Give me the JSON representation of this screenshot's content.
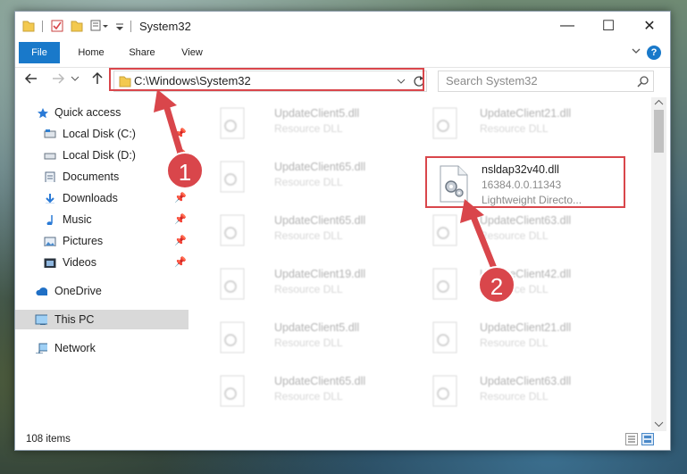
{
  "window": {
    "title": "System32",
    "controls": {
      "minimize": "—",
      "maximize": "☐",
      "close": "✕"
    }
  },
  "ribbon": {
    "tabs": [
      {
        "label": "File"
      },
      {
        "label": "Home"
      },
      {
        "label": "Share"
      },
      {
        "label": "View"
      }
    ],
    "help": "?"
  },
  "nav": {
    "address": "C:\\Windows\\System32",
    "search_placeholder": "Search System32"
  },
  "sidebar": {
    "items": [
      {
        "label": "Quick access",
        "icon": "star-icon"
      },
      {
        "label": "Local Disk (C:)",
        "icon": "drive-icon"
      },
      {
        "label": "Local Disk (D:)",
        "icon": "drive-icon"
      },
      {
        "label": "Documents",
        "icon": "documents-icon"
      },
      {
        "label": "Downloads",
        "icon": "download-icon"
      },
      {
        "label": "Music",
        "icon": "music-icon"
      },
      {
        "label": "Pictures",
        "icon": "pictures-icon"
      },
      {
        "label": "Videos",
        "icon": "videos-icon"
      },
      {
        "label": "OneDrive",
        "icon": "cloud-icon"
      },
      {
        "label": "This PC",
        "icon": "computer-icon"
      },
      {
        "label": "Network",
        "icon": "network-icon"
      }
    ]
  },
  "files": {
    "left": [
      {
        "name": "UpdateClient5.dll",
        "type": "Resource DLL"
      },
      {
        "name": "UpdateClient65.dll",
        "type": "Resource DLL"
      },
      {
        "name": "UpdateClient65.dll",
        "type": "Resource DLL"
      },
      {
        "name": "UpdateClient19.dll",
        "type": "Resource DLL"
      },
      {
        "name": "UpdateClient5.dll",
        "type": "Resource DLL"
      },
      {
        "name": "UpdateClient65.dll",
        "type": "Resource DLL"
      }
    ],
    "right": [
      {
        "name": "UpdateClient21.dll",
        "type": "Resource DLL"
      },
      {
        "name": "UpdateClient63.dll",
        "type": "Resource DLL"
      },
      {
        "name": "UpdateClient42.dll",
        "type": "Resource DLL"
      },
      {
        "name": "UpdateClient21.dll",
        "type": "Resource DLL"
      },
      {
        "name": "UpdateClient63.dll",
        "type": "Resource DLL"
      }
    ],
    "highlighted": {
      "name": "nsldap32v40.dll",
      "version": "16384.0.0.11343",
      "description": "Lightweight Directo..."
    }
  },
  "status": {
    "items": "108 items"
  },
  "annotations": {
    "step1": "1",
    "step2": "2"
  },
  "colors": {
    "accent": "#1979ca",
    "highlight": "#d9464b"
  }
}
